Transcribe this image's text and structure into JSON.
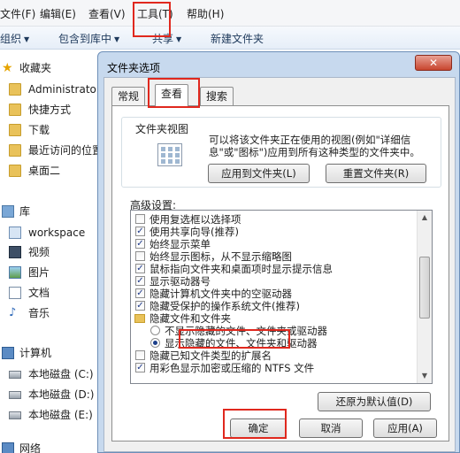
{
  "menubar": {
    "items": [
      "文件(F)",
      "编辑(E)",
      "查看(V)",
      "工具(T)",
      "帮助(H)"
    ]
  },
  "commandbar": {
    "organize": "组织",
    "include_library": "包含到库中",
    "share": "共享",
    "new_folder": "新建文件夹"
  },
  "nav": {
    "favorites": "收藏夹",
    "fav_items": [
      "Administrator",
      "快捷方式",
      "下载",
      "最近访问的位置",
      "桌面二"
    ],
    "libraries": "库",
    "lib_items": [
      "workspace",
      "视频",
      "图片",
      "文档",
      "音乐"
    ],
    "computer": "计算机",
    "drives": [
      "本地磁盘 (C:)",
      "本地磁盘 (D:)",
      "本地磁盘 (E:)"
    ],
    "network": "网络"
  },
  "dialog": {
    "title": "文件夹选项",
    "tabs": [
      "常规",
      "查看",
      "搜索"
    ],
    "active_tab": "查看",
    "folder_view": {
      "title": "文件夹视图",
      "description": "可以将该文件夹正在使用的视图(例如\"详细信息\"或\"图标\")应用到所有这种类型的文件夹中。",
      "apply_button": "应用到文件夹(L)",
      "reset_button": "重置文件夹(R)"
    },
    "advanced": {
      "label": "高级设置:",
      "items": [
        {
          "kind": "checkbox",
          "checked": false,
          "text": "使用复选框以选择项"
        },
        {
          "kind": "checkbox",
          "checked": true,
          "text": "使用共享向导(推荐)"
        },
        {
          "kind": "checkbox",
          "checked": true,
          "text": "始终显示菜单"
        },
        {
          "kind": "checkbox",
          "checked": false,
          "text": "始终显示图标，从不显示缩略图"
        },
        {
          "kind": "checkbox",
          "checked": true,
          "text": "鼠标指向文件夹和桌面项时显示提示信息"
        },
        {
          "kind": "checkbox",
          "checked": true,
          "text": "显示驱动器号"
        },
        {
          "kind": "checkbox",
          "checked": true,
          "text": "隐藏计算机文件夹中的空驱动器"
        },
        {
          "kind": "checkbox",
          "checked": true,
          "text": "隐藏受保护的操作系统文件(推荐)"
        },
        {
          "kind": "folder",
          "text": "隐藏文件和文件夹"
        },
        {
          "kind": "radio",
          "checked": false,
          "text": "不显示隐藏的文件、文件夹或驱动器"
        },
        {
          "kind": "radio",
          "checked": true,
          "text": "显示隐藏的文件、文件夹和驱动器"
        },
        {
          "kind": "checkbox",
          "checked": false,
          "text": "隐藏已知文件类型的扩展名"
        },
        {
          "kind": "checkbox",
          "checked": true,
          "text": "用彩色显示加密或压缩的 NTFS 文件"
        }
      ],
      "restore_button": "还原为默认值(D)"
    },
    "ok_button": "确定",
    "cancel_button": "取消",
    "apply_button": "应用(A)",
    "close_glyph": "✕"
  },
  "colors": {
    "highlight": "#e0281e",
    "dialog_frame": "#c7d9ee"
  }
}
